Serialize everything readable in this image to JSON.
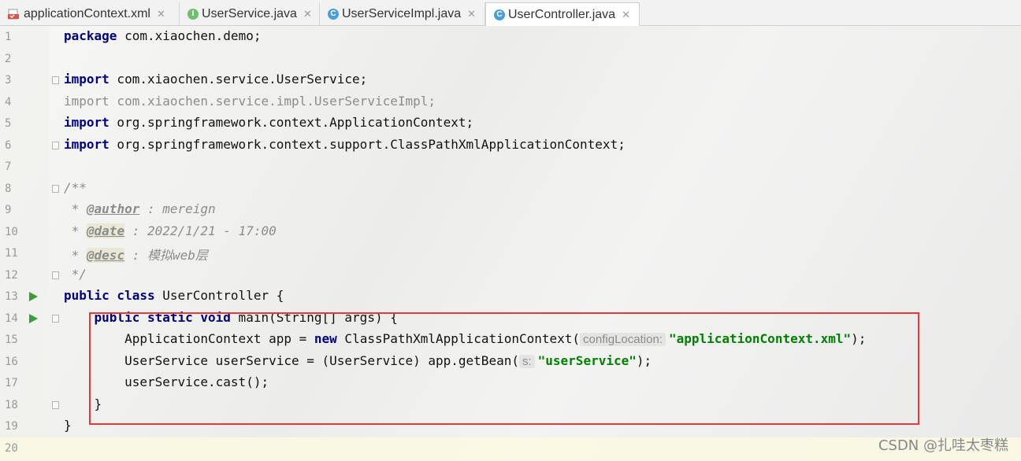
{
  "tabs": [
    {
      "label": "applicationContext.xml",
      "icon": "xml-file-icon",
      "active": false
    },
    {
      "label": "UserService.java",
      "icon": "interface-icon",
      "active": false
    },
    {
      "label": "UserServiceImpl.java",
      "icon": "class-icon",
      "active": false
    },
    {
      "label": "UserController.java",
      "icon": "class-icon",
      "active": true
    }
  ],
  "tab_close": "✕",
  "lines": {
    "n1": "1",
    "n2": "2",
    "n3": "3",
    "n4": "4",
    "n5": "5",
    "n6": "6",
    "n7": "7",
    "n8": "8",
    "n9": "9",
    "n10": "10",
    "n11": "11",
    "n12": "12",
    "n13": "13",
    "n14": "14",
    "n15": "15",
    "n16": "16",
    "n17": "17",
    "n18": "18",
    "n19": "19",
    "n20": "20"
  },
  "code": {
    "l1_kw": "package",
    "l1_rest": " com.xiaochen.demo;",
    "l3_kw": "import",
    "l3_rest": " com.xiaochen.service.UserService;",
    "l4_kw": "import",
    "l4_rest": " com.xiaochen.service.impl.UserServiceImpl;",
    "l5_kw": "import",
    "l5_rest": " org.springframework.context.ApplicationContext;",
    "l6_kw": "import",
    "l6_rest": " org.springframework.context.support.ClassPathXmlApplicationContext;",
    "l8": "/**",
    "l9_pre": " * ",
    "l9_tag": "@author",
    "l9_rest": " : mereign",
    "l10_pre": " * ",
    "l10_tag": "@date",
    "l10_rest": " : 2022/1/21 - 17:00",
    "l11_pre": " * ",
    "l11_tag": "@desc",
    "l11_rest": " : 模拟web层",
    "l12": " */",
    "l13_kw": "public class",
    "l13_rest": " UserController {",
    "l14_indent": "    ",
    "l14_kw": "public static void",
    "l14_rest": " main(String[] args) {",
    "l15_a": "        ApplicationContext app = ",
    "l15_kw": "new",
    "l15_b": " ClassPathXmlApplicationContext(",
    "l15_hint": "configLocation:",
    "l15_str": "\"applicationContext.xml\"",
    "l15_end": ");",
    "l16_a": "        UserService userService = (UserService) app.getBean(",
    "l16_hint": "s:",
    "l16_str": "\"userService\"",
    "l16_end": ");",
    "l17": "        userService.cast();",
    "l18": "    }",
    "l19": "}"
  },
  "watermark": "CSDN @扎哇太枣糕",
  "colors": {
    "keyword": "#000080",
    "string": "#008000",
    "comment": "#8c8c8c",
    "highlight_border": "#e03a3a",
    "run_icon": "#3b9c3b"
  }
}
